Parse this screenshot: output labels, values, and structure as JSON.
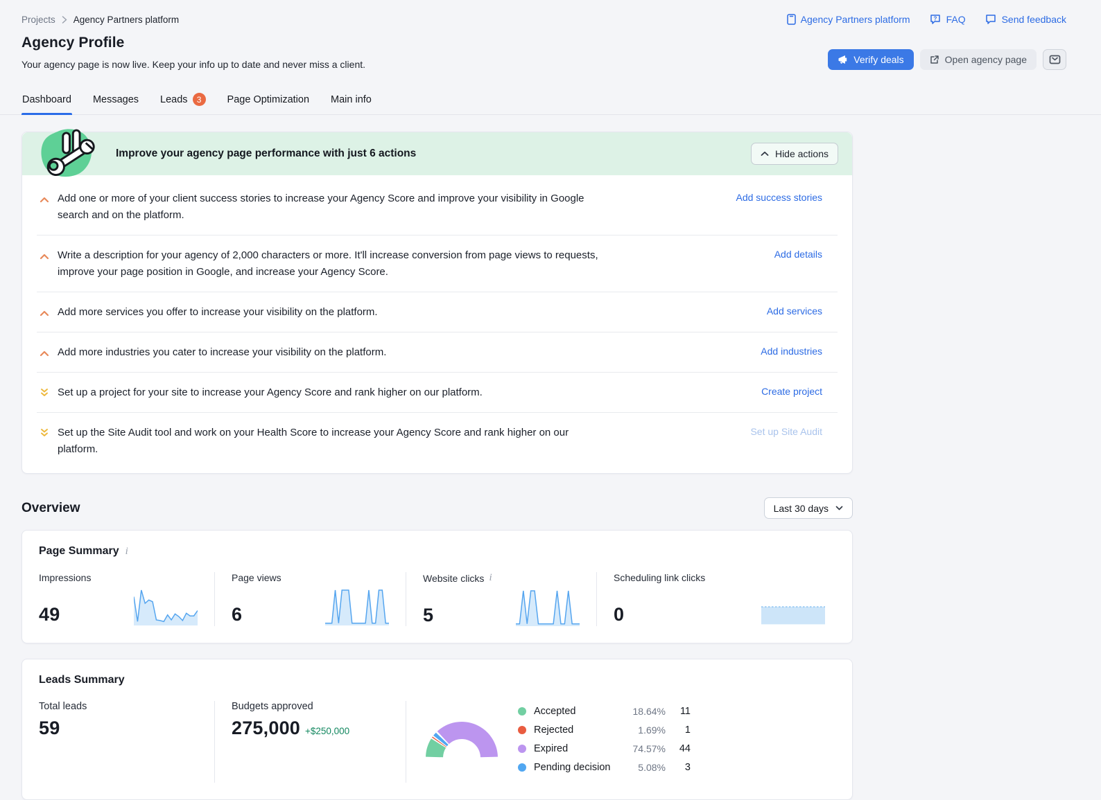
{
  "icons": {
    "info": "i",
    "question": "?"
  },
  "colors": {
    "page_background": "#f4f5f8",
    "primary_blue": "#3b79e6",
    "link_blue": "#2c6be4",
    "banner_green": "#ddf2e6",
    "badge_orange": "#ea6a42",
    "chevron_high_priority": "#e8895a",
    "chevron_low_priority": "#edb93e",
    "sparkline_blue": "#55a5ef",
    "delta_green": "#12875f"
  },
  "breadcrumb": {
    "projects": "Projects",
    "current": "Agency Partners platform"
  },
  "header": {
    "title": "Agency Profile",
    "subtitle": "Your agency page is now live. Keep your info up to date and never miss a client.",
    "links": [
      "Agency Partners platform",
      "FAQ",
      "Send feedback"
    ],
    "buttons": {
      "verify_deals": "Verify deals",
      "open_agency_page": "Open agency page"
    }
  },
  "tabs": [
    {
      "label": "Dashboard",
      "active": true
    },
    {
      "label": "Messages"
    },
    {
      "label": "Leads",
      "badge": "3"
    },
    {
      "label": "Page Optimization"
    },
    {
      "label": "Main info"
    }
  ],
  "actions_panel": {
    "title": "Improve your agency page performance with just 6 actions",
    "hide_button": "Hide actions",
    "items": [
      {
        "text": "Add one or more of your client success stories to increase your Agency Score and improve your visibility in Google search and on the platform.",
        "link": "Add success stories",
        "priority": "high"
      },
      {
        "text": "Write a description for your agency of 2,000 characters or more. It'll increase conversion from page views to requests, improve your page position in Google, and increase your Agency Score.",
        "link": "Add details",
        "priority": "high"
      },
      {
        "text": "Add more services you offer to increase your visibility on the platform.",
        "link": "Add services",
        "priority": "high"
      },
      {
        "text": "Add more industries you cater to increase your visibility on the platform.",
        "link": "Add industries",
        "priority": "high"
      },
      {
        "text": "Set up a project for your site to increase your Agency Score and rank higher on our platform.",
        "link": "Create project",
        "priority": "low"
      },
      {
        "text": "Set up the Site Audit tool and work on your Health Score to increase your Agency Score and rank higher on our platform.",
        "link": "Set up Site Audit",
        "priority": "low",
        "link_disabled": true
      }
    ]
  },
  "overview": {
    "title": "Overview",
    "period": "Last 30 days"
  },
  "page_summary": {
    "title": "Page Summary",
    "metrics": [
      {
        "label": "Impressions",
        "value": "49"
      },
      {
        "label": "Page views",
        "value": "6"
      },
      {
        "label": "Website clicks",
        "value": "5",
        "info": true
      },
      {
        "label": "Scheduling link clicks",
        "value": "0"
      }
    ]
  },
  "leads_summary": {
    "title": "Leads Summary",
    "total_leads_label": "Total leads",
    "total_leads": "59",
    "budgets_label": "Budgets approved",
    "budgets_value": "275,000",
    "budgets_delta": "+$250,000"
  },
  "chart_data": {
    "impressions_sparkline": {
      "type": "area",
      "metric": "Impressions",
      "period": "Last 30 days",
      "color": "#55a5ef",
      "fill": "#d6eafb",
      "values": [
        8,
        0.5,
        10,
        6,
        7,
        6.5,
        1,
        0.8,
        0.5,
        2.5,
        1,
        2.8,
        2,
        0.8,
        3,
        2.2,
        2.2,
        3.8
      ]
    },
    "page_views_sparkline": {
      "type": "area",
      "metric": "Page views",
      "period": "Last 30 days",
      "color": "#55a5ef",
      "fill": "#d6eafb",
      "values": [
        0,
        0,
        0,
        6,
        0,
        6,
        6,
        6,
        0,
        0,
        0,
        0,
        0,
        6,
        0,
        0,
        6,
        6,
        0,
        0
      ]
    },
    "website_clicks_sparkline": {
      "type": "area",
      "metric": "Website clicks",
      "period": "Last 30 days",
      "color": "#55a5ef",
      "fill": "#d6eafb",
      "values": [
        0,
        0,
        2,
        0,
        2,
        2,
        0,
        0,
        0,
        0,
        0,
        2,
        0,
        0,
        2,
        0,
        0,
        0
      ]
    },
    "scheduling_sparkline": {
      "type": "area",
      "metric": "Scheduling link clicks",
      "period": "Last 30 days",
      "color": "#8ec4f2",
      "fill": "#cde5f9",
      "flat_band": true,
      "values": [
        0,
        0,
        0,
        0,
        0,
        0,
        0,
        0,
        0,
        0,
        0,
        0,
        0,
        0,
        0,
        0,
        0,
        0
      ]
    },
    "leads_donut": {
      "type": "pie",
      "shape": "half-donut",
      "title": "Leads Summary",
      "segments": [
        {
          "label": "Accepted",
          "pct": 18.64,
          "percent_label": "18.64%",
          "count": 11,
          "color": "#72cfa2"
        },
        {
          "label": "Rejected",
          "pct": 1.69,
          "percent_label": "1.69%",
          "count": 1,
          "color": "#e95c40"
        },
        {
          "label": "Expired",
          "pct": 74.57,
          "percent_label": "74.57%",
          "count": 44,
          "color": "#bc95ef"
        },
        {
          "label": "Pending decision",
          "pct": 5.08,
          "percent_label": "5.08%",
          "count": 3,
          "color": "#51a7f1"
        }
      ],
      "draw_order": [
        0,
        1,
        3,
        2
      ]
    }
  }
}
